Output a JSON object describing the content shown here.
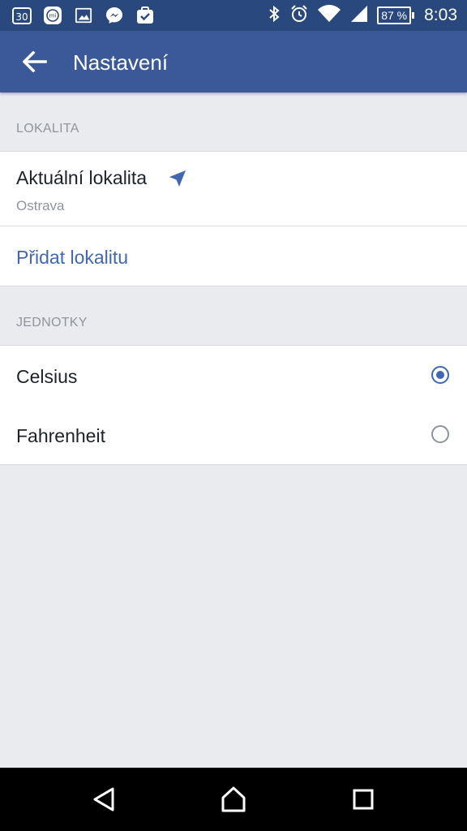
{
  "status_bar": {
    "left_icons": [
      "calendar-icon",
      "mi-app-icon",
      "gallery-icon",
      "messenger-icon",
      "task-check-icon"
    ],
    "calendar_day": "30",
    "mi_label": "mi",
    "battery_level": "87 %",
    "time": "8:03"
  },
  "app_bar": {
    "title": "Nastavení",
    "background": "#3b5998"
  },
  "sections": {
    "location": {
      "header": "LOKALITA",
      "current_label": "Aktuální lokalita",
      "current_value": "Ostrava",
      "add_label": "Přidat lokalitu"
    },
    "units": {
      "header": "JEDNOTKY",
      "options": [
        {
          "label": "Celsius",
          "selected": true
        },
        {
          "label": "Fahrenheit",
          "selected": false
        }
      ]
    }
  },
  "colors": {
    "accent": "#4267b2",
    "status_bar": "#29487d",
    "background": "#e9ebee"
  }
}
